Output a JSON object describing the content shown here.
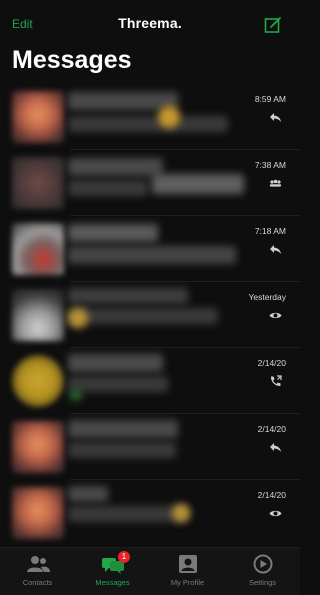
{
  "header": {
    "edit_label": "Edit",
    "app_title": "Threema.",
    "page_title": "Messages"
  },
  "conversations": [
    {
      "time": "8:59 AM",
      "status_icon": "reply-icon"
    },
    {
      "time": "7:38 AM",
      "status_icon": "group-icon"
    },
    {
      "time": "7:18 AM",
      "status_icon": "reply-icon"
    },
    {
      "time": "Yesterday",
      "status_icon": "eye-icon"
    },
    {
      "time": "2/14/20",
      "status_icon": "phone-icon"
    },
    {
      "time": "2/14/20",
      "status_icon": "reply-icon"
    },
    {
      "time": "2/14/20",
      "status_icon": "eye-icon"
    }
  ],
  "tabs": [
    {
      "label": "Contacts",
      "icon": "contacts-icon"
    },
    {
      "label": "Messages",
      "icon": "messages-icon",
      "badge": "1"
    },
    {
      "label": "My Profile",
      "icon": "profile-icon"
    },
    {
      "label": "Settings",
      "icon": "settings-icon"
    }
  ],
  "colors": {
    "accent": "#21a84a",
    "badge": "#e8242b",
    "background": "#0e0e0e"
  }
}
